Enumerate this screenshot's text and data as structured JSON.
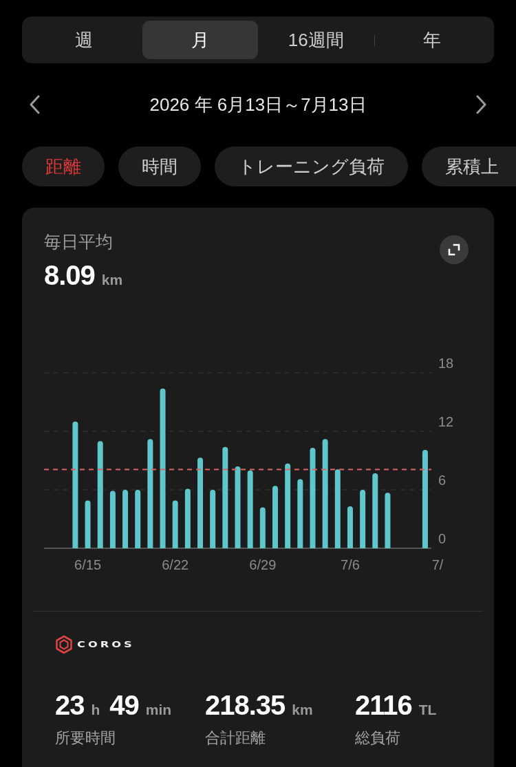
{
  "period_tabs": [
    {
      "label": "週",
      "selected": false
    },
    {
      "label": "月",
      "selected": true
    },
    {
      "label": "16週間",
      "selected": false
    },
    {
      "label": "年",
      "selected": false
    }
  ],
  "date_range": {
    "label": "2026 年 6月13日～7月13日"
  },
  "metric_chips": [
    {
      "label": "距離",
      "selected": true
    },
    {
      "label": "時間",
      "selected": false
    },
    {
      "label": "トレーニング負荷",
      "selected": false
    },
    {
      "label": "累積上",
      "selected": false
    }
  ],
  "summary_card": {
    "title": "毎日平均",
    "value": "8.09",
    "unit": "km",
    "chart_data": {
      "type": "bar",
      "categories": [
        null,
        null,
        "6/15",
        null,
        null,
        null,
        null,
        null,
        null,
        "6/22",
        null,
        null,
        null,
        null,
        null,
        null,
        "6/29",
        null,
        null,
        null,
        null,
        null,
        null,
        "7/6",
        null,
        null,
        null,
        null,
        null,
        null,
        "7/"
      ],
      "values": [
        null,
        13.0,
        4.9,
        11.0,
        5.9,
        6.0,
        6.0,
        11.2,
        16.4,
        4.9,
        6.1,
        9.3,
        6.0,
        10.4,
        8.4,
        8.0,
        4.2,
        6.4,
        8.7,
        7.1,
        10.3,
        11.2,
        8.1,
        4.3,
        6.0,
        7.7,
        5.7,
        null,
        null,
        10.1,
        null
      ],
      "ylim": [
        0,
        18
      ],
      "yticks": [
        0,
        6,
        12,
        18
      ],
      "ref_lines": [
        {
          "axis": "y",
          "value": 8.09
        }
      ]
    },
    "brand": "COROS",
    "stats": [
      {
        "parts": [
          {
            "value": "23",
            "unit": "h"
          },
          {
            "value": "49",
            "unit": "min"
          }
        ],
        "label": "所要時間"
      },
      {
        "parts": [
          {
            "value": "218.35",
            "unit": "km"
          }
        ],
        "label": "合計距離"
      },
      {
        "parts": [
          {
            "value": "2116",
            "unit": "TL"
          }
        ],
        "label": "総負荷"
      }
    ]
  }
}
